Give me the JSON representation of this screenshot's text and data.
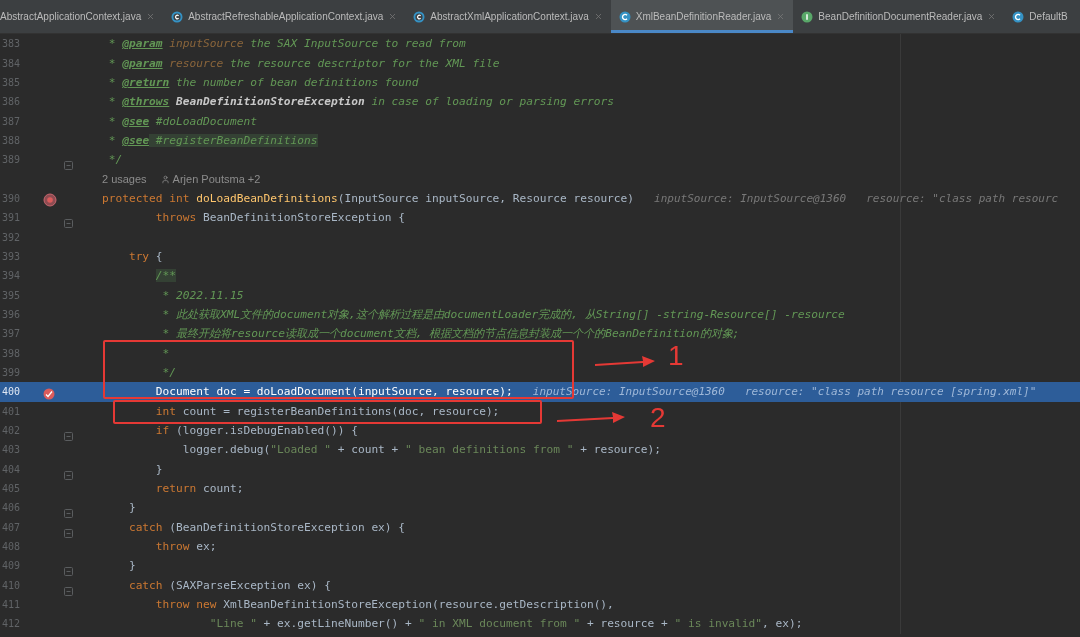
{
  "tabs": [
    {
      "label": "AbstractApplicationContext.java",
      "selected": false
    },
    {
      "label": "AbstractRefreshableApplicationContext.java",
      "kind": "abstract",
      "selected": false
    },
    {
      "label": "AbstractXmlApplicationContext.java",
      "kind": "abstract",
      "selected": false
    },
    {
      "label": "XmlBeanDefinitionReader.java",
      "kind": "class",
      "selected": true
    },
    {
      "label": "BeanDefinitionDocumentReader.java",
      "kind": "interface",
      "selected": false
    },
    {
      "label": "DefaultB",
      "kind": "class",
      "selected": false
    }
  ],
  "lines": [
    {
      "kind": "code",
      "num": "383",
      "segs": [
        {
          "text": "     * ",
          "kind": "doc"
        },
        {
          "text": "@param",
          "kind": "doctag"
        },
        {
          "text": " inputSource",
          "kind": "docparam"
        },
        {
          "text": " the SAX InputSource to read from",
          "kind": "doc"
        }
      ]
    },
    {
      "kind": "code",
      "num": "384",
      "segs": [
        {
          "text": "     * ",
          "kind": "doc"
        },
        {
          "text": "@param",
          "kind": "doctag"
        },
        {
          "text": " resource",
          "kind": "docparam"
        },
        {
          "text": " the resource descriptor for the XML file",
          "kind": "doc"
        }
      ]
    },
    {
      "kind": "code",
      "num": "385",
      "segs": [
        {
          "text": "     * ",
          "kind": "doc"
        },
        {
          "text": "@return",
          "kind": "doctag"
        },
        {
          "text": " the number of bean definitions found",
          "kind": "doc"
        }
      ]
    },
    {
      "kind": "code",
      "num": "386",
      "segs": [
        {
          "text": "     * ",
          "kind": "doc"
        },
        {
          "text": "@throws",
          "kind": "doctag"
        },
        {
          "text": " BeanDefinitionStoreException",
          "kind": "docref"
        },
        {
          "text": " in case of loading or parsing errors",
          "kind": "doc"
        }
      ]
    },
    {
      "kind": "code",
      "num": "387",
      "segs": [
        {
          "text": "     * ",
          "kind": "doc"
        },
        {
          "text": "@see",
          "kind": "doctag"
        },
        {
          "text": " #doLoadDocument",
          "kind": "doc"
        }
      ]
    },
    {
      "kind": "code",
      "num": "388",
      "segs": [
        {
          "text": "     * ",
          "kind": "doc"
        },
        {
          "text": "@see",
          "kind": "doctag"
        },
        {
          "text": " #registerBeanDefinitions",
          "kind": "dochl"
        }
      ]
    },
    {
      "kind": "code",
      "num": "389",
      "fold": true,
      "segs": [
        {
          "text": "     */",
          "kind": "doc"
        }
      ]
    },
    {
      "kind": "usages",
      "usages": "2 usages",
      "author": "Arjen Poutsma +2"
    },
    {
      "kind": "code",
      "num": "390",
      "gutter_icon": {
        "kind": "method-breakpoint"
      },
      "segs": [
        {
          "text": "    protected int ",
          "kind": "kw"
        },
        {
          "text": "doLoadBeanDefinitions",
          "kind": "fn"
        },
        {
          "text": "(InputSource inputSource, Resource resource)",
          "kind": "plain"
        }
      ],
      "hints": [
        "inputSource: InputSource@1360",
        "resource: \"class path resourc"
      ]
    },
    {
      "kind": "code",
      "num": "391",
      "fold": true,
      "segs": [
        {
          "text": "            throws",
          "kind": "kw"
        },
        {
          "text": " BeanDefinitionStoreException {",
          "kind": "plain"
        }
      ]
    },
    {
      "kind": "code",
      "num": "392"
    },
    {
      "kind": "code",
      "num": "393",
      "segs": [
        {
          "text": "        try",
          "kind": "kw"
        },
        {
          "text": " {",
          "kind": "plain"
        }
      ]
    },
    {
      "kind": "code",
      "num": "394",
      "segs": [
        {
          "text": "            /**",
          "kind": "dochl"
        }
      ]
    },
    {
      "kind": "code",
      "num": "395",
      "segs": [
        {
          "text": "             * 2022.11.15",
          "kind": "doc"
        }
      ]
    },
    {
      "kind": "code",
      "num": "396",
      "segs": [
        {
          "text": "             * 此处获取XML文件的document对象,这个解析过程是由documentLoader完成的, 从String[] -string-Resource[] -resource",
          "kind": "doc"
        }
      ]
    },
    {
      "kind": "code",
      "num": "397",
      "segs": [
        {
          "text": "             * 最终开始将resource读取成一个document文档, 根据文档的节点信息封装成一个个的BeanDefinition的对象;",
          "kind": "doc"
        }
      ]
    },
    {
      "kind": "code",
      "num": "398",
      "segs": [
        {
          "text": "             *",
          "kind": "doc"
        }
      ]
    },
    {
      "kind": "code",
      "num": "399",
      "segs": [
        {
          "text": "             */",
          "kind": "doc"
        }
      ]
    },
    {
      "kind": "code",
      "num": "400",
      "gutter_icon": {
        "kind": "breakpoint"
      },
      "current": true,
      "segs": [
        {
          "text": "            Document doc = doLoadDocument(inputSource, resource);",
          "kind": "plain"
        }
      ],
      "hints": [
        "inputSource: InputSource@1360",
        "resource: \"class path resource [spring.xml]\""
      ]
    },
    {
      "kind": "code",
      "num": "401",
      "segs": [
        {
          "text": "            int",
          "kind": "kw"
        },
        {
          "text": " count = registerBeanDefinitions(doc, resource);",
          "kind": "plain"
        }
      ]
    },
    {
      "kind": "code",
      "num": "402",
      "fold": true,
      "segs": [
        {
          "text": "            if",
          "kind": "kw"
        },
        {
          "text": " (logger.isDebugEnabled()) {",
          "kind": "plain"
        }
      ]
    },
    {
      "kind": "code",
      "num": "403",
      "segs": [
        {
          "text": "                logger.debug(",
          "kind": "plain"
        },
        {
          "text": "\"Loaded \"",
          "kind": "str"
        },
        {
          "text": " + count + ",
          "kind": "plain"
        },
        {
          "text": "\" bean definitions from \"",
          "kind": "str"
        },
        {
          "text": " + resource);",
          "kind": "plain"
        }
      ]
    },
    {
      "kind": "code",
      "num": "404",
      "fold": true,
      "segs": [
        {
          "text": "            }",
          "kind": "plain"
        }
      ]
    },
    {
      "kind": "code",
      "num": "405",
      "segs": [
        {
          "text": "            return",
          "kind": "kw"
        },
        {
          "text": " count;",
          "kind": "plain"
        }
      ]
    },
    {
      "kind": "code",
      "num": "406",
      "fold": true,
      "segs": [
        {
          "text": "        }",
          "kind": "plain"
        }
      ]
    },
    {
      "kind": "code",
      "num": "407",
      "fold": true,
      "segs": [
        {
          "text": "        catch",
          "kind": "kw"
        },
        {
          "text": " (BeanDefinitionStoreException ex) {",
          "kind": "plain"
        }
      ]
    },
    {
      "kind": "code",
      "num": "408",
      "segs": [
        {
          "text": "            throw",
          "kind": "kw"
        },
        {
          "text": " ex;",
          "kind": "plain"
        }
      ]
    },
    {
      "kind": "code",
      "num": "409",
      "fold": true,
      "segs": [
        {
          "text": "        }",
          "kind": "plain"
        }
      ]
    },
    {
      "kind": "code",
      "num": "410",
      "fold": true,
      "segs": [
        {
          "text": "        catch",
          "kind": "kw"
        },
        {
          "text": " (SAXParseException ex) {",
          "kind": "plain"
        }
      ]
    },
    {
      "kind": "code",
      "num": "411",
      "segs": [
        {
          "text": "            throw new",
          "kind": "kw"
        },
        {
          "text": " XmlBeanDefinitionStoreException(resource.getDescription(),",
          "kind": "plain"
        }
      ]
    },
    {
      "kind": "code",
      "num": "412",
      "segs": [
        {
          "text": "                    \"Line \"",
          "kind": "str"
        },
        {
          "text": " + ex.getLineNumber() + ",
          "kind": "plain"
        },
        {
          "text": "\" in XML document from \"",
          "kind": "str"
        },
        {
          "text": " + resource + ",
          "kind": "plain"
        },
        {
          "text": "\" is invalid\"",
          "kind": "str"
        },
        {
          "text": ", ex);",
          "kind": "plain"
        }
      ]
    }
  ],
  "annotations": [
    {
      "label": "1"
    },
    {
      "label": "2"
    }
  ]
}
